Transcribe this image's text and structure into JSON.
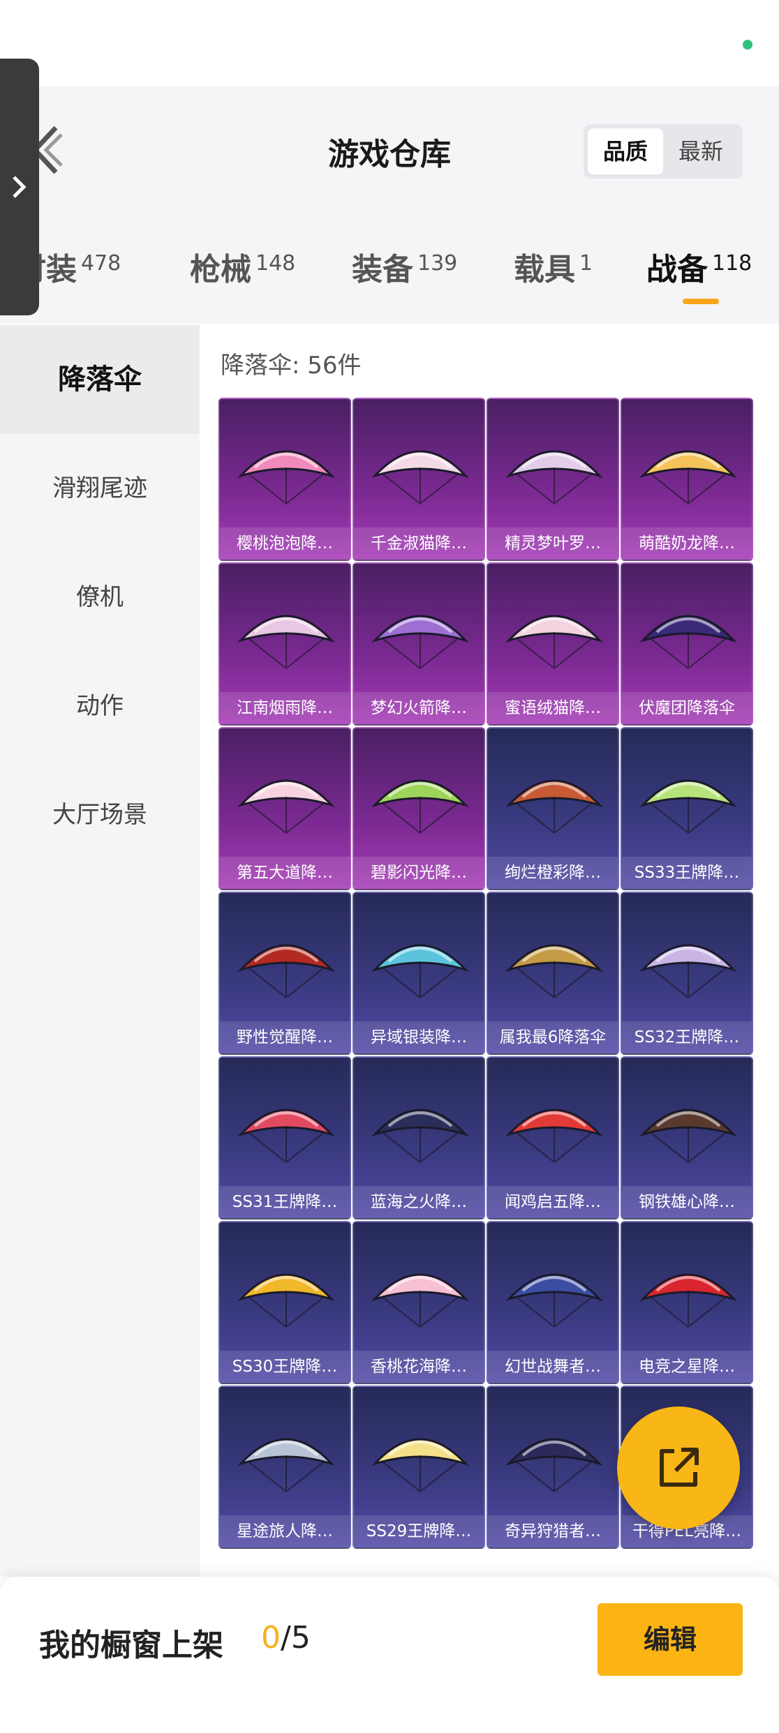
{
  "header": {
    "title": "游戏仓库"
  },
  "sort": {
    "active": "品质",
    "inactive": "最新"
  },
  "tabs": [
    {
      "label": "时装",
      "count": "478"
    },
    {
      "label": "枪械",
      "count": "148"
    },
    {
      "label": "装备",
      "count": "139"
    },
    {
      "label": "载具",
      "count": "1"
    },
    {
      "label": "战备",
      "count": "118"
    }
  ],
  "sidebar": {
    "items": [
      {
        "label": "降落伞"
      },
      {
        "label": "滑翔尾迹"
      },
      {
        "label": "僚机"
      },
      {
        "label": "动作"
      },
      {
        "label": "大厅场景"
      }
    ]
  },
  "content": {
    "count_label": "降落伞: 56件"
  },
  "items": [
    {
      "name": "樱桃泡泡降…",
      "rarity": "purple",
      "color": "#f08abb"
    },
    {
      "name": "千金淑猫降…",
      "rarity": "purple",
      "color": "#f3d9e6"
    },
    {
      "name": "精灵梦叶罗…",
      "rarity": "purple",
      "color": "#e2cde8"
    },
    {
      "name": "萌酷奶龙降…",
      "rarity": "purple",
      "color": "#f6c25a"
    },
    {
      "name": "江南烟雨降…",
      "rarity": "purple",
      "color": "#e8c7e2"
    },
    {
      "name": "梦幻火箭降…",
      "rarity": "purple",
      "color": "#9d6fd2"
    },
    {
      "name": "蜜语绒猫降…",
      "rarity": "purple",
      "color": "#f3d3dd"
    },
    {
      "name": "伏魔团降落伞",
      "rarity": "purple",
      "color": "#3a2a78"
    },
    {
      "name": "第五大道降…",
      "rarity": "purple",
      "color": "#f7d3df"
    },
    {
      "name": "碧影闪光降…",
      "rarity": "purple",
      "color": "#9fd45b"
    },
    {
      "name": "绚烂橙彩降…",
      "rarity": "blue",
      "color": "#c85a35"
    },
    {
      "name": "SS33王牌降…",
      "rarity": "blue",
      "color": "#b6e37a"
    },
    {
      "name": "野性觉醒降…",
      "rarity": "blue",
      "color": "#b22a20"
    },
    {
      "name": "异域银装降…",
      "rarity": "blue",
      "color": "#5bc4dc"
    },
    {
      "name": "属我最6降落伞",
      "rarity": "blue",
      "color": "#c49a44"
    },
    {
      "name": "SS32王牌降…",
      "rarity": "blue",
      "color": "#c9b4e6"
    },
    {
      "name": "SS31王牌降…",
      "rarity": "blue",
      "color": "#e24a62"
    },
    {
      "name": "蓝海之火降…",
      "rarity": "blue",
      "color": "#2a2f5a"
    },
    {
      "name": "闻鸡启五降…",
      "rarity": "blue",
      "color": "#e23a36"
    },
    {
      "name": "钢铁雄心降…",
      "rarity": "blue",
      "color": "#5a3a2e"
    },
    {
      "name": "SS30王牌降…",
      "rarity": "blue",
      "color": "#f1b82a"
    },
    {
      "name": "香桃花海降…",
      "rarity": "blue",
      "color": "#f6bfd2"
    },
    {
      "name": "幻世战舞者…",
      "rarity": "blue",
      "color": "#3b4ea3"
    },
    {
      "name": "电竞之星降…",
      "rarity": "blue",
      "color": "#d9262e"
    },
    {
      "name": "星途旅人降…",
      "rarity": "blue",
      "color": "#b8c4d6"
    },
    {
      "name": "SS29王牌降…",
      "rarity": "blue",
      "color": "#f5e08a"
    },
    {
      "name": "奇异狩猎者…",
      "rarity": "blue",
      "color": "#2b2a5a"
    },
    {
      "name": "干得PEL亮降…",
      "rarity": "blue",
      "color": "#e24a3a"
    }
  ],
  "footer": {
    "label": "我的橱窗上架",
    "current": "0",
    "total": "/5",
    "edit_label": "编辑"
  }
}
